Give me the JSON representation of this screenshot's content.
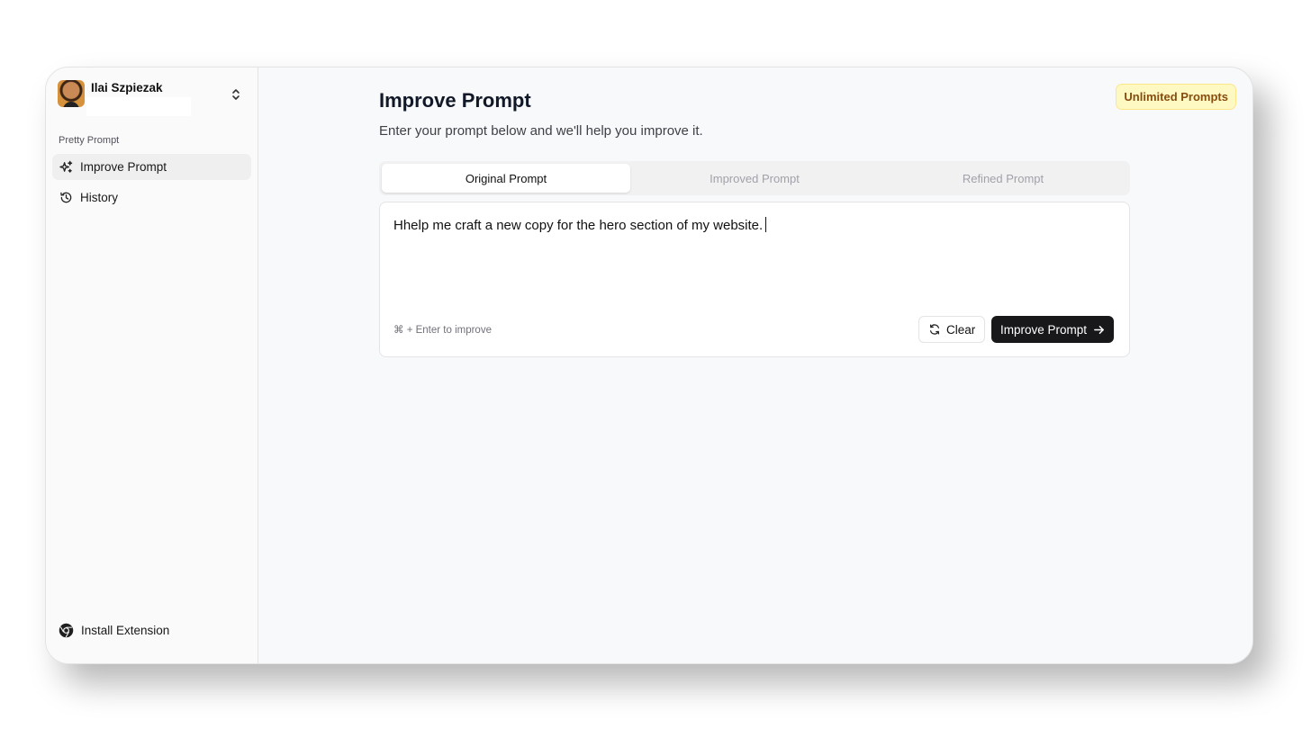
{
  "user": {
    "name": "Ilai Szpiezak"
  },
  "sidebar": {
    "group_label": "Pretty Prompt",
    "items": [
      {
        "label": "Improve Prompt",
        "icon": "sparkles-icon",
        "active": true
      },
      {
        "label": "History",
        "icon": "history-icon",
        "active": false
      }
    ],
    "footer": {
      "label": "Install Extension",
      "icon": "chrome-icon"
    }
  },
  "header": {
    "title": "Improve Prompt",
    "subtitle": "Enter your prompt below and we'll help you improve it.",
    "badge": "Unlimited Prompts"
  },
  "tabs": [
    {
      "label": "Original Prompt",
      "active": true
    },
    {
      "label": "Improved Prompt",
      "active": false
    },
    {
      "label": "Refined Prompt",
      "active": false
    }
  ],
  "editor": {
    "value": "Hhelp me craft a new copy for the hero section of my website.",
    "hint": "⌘ + Enter to improve",
    "clear_label": "Clear",
    "improve_label": "Improve Prompt"
  },
  "colors": {
    "badge_bg": "#fef9c3",
    "badge_text": "#854d0e",
    "primary_button": "#18181b"
  }
}
